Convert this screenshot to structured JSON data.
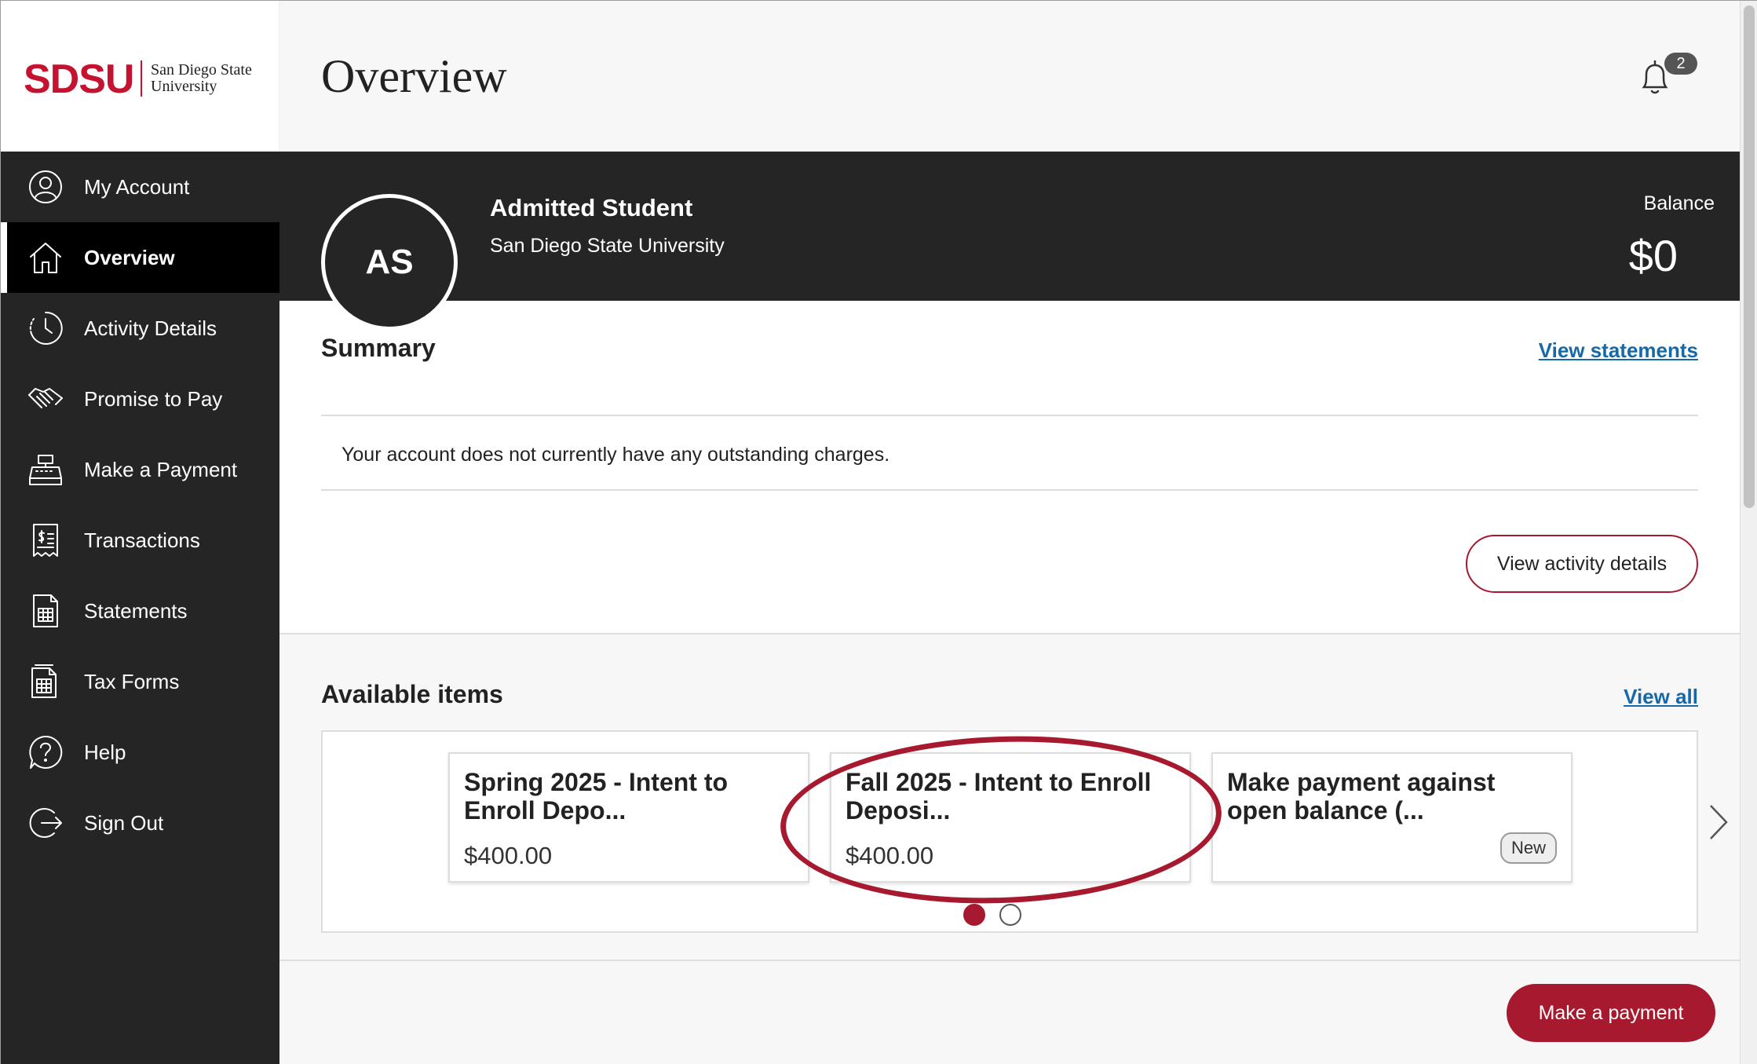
{
  "brand": {
    "logo_mark": "SDSU",
    "logo_line1": "San Diego State",
    "logo_line2": "University",
    "accent_color": "#a6192e"
  },
  "sidebar": {
    "items": [
      {
        "label": "My Account",
        "icon": "user-circle-icon",
        "active": false
      },
      {
        "label": "Overview",
        "icon": "home-icon",
        "active": true
      },
      {
        "label": "Activity Details",
        "icon": "clock-icon",
        "active": false
      },
      {
        "label": "Promise to Pay",
        "icon": "handshake-icon",
        "active": false
      },
      {
        "label": "Make a Payment",
        "icon": "cash-register-icon",
        "active": false
      },
      {
        "label": "Transactions",
        "icon": "receipt-icon",
        "active": false
      },
      {
        "label": "Statements",
        "icon": "document-table-icon",
        "active": false
      },
      {
        "label": "Tax Forms",
        "icon": "tax-form-icon",
        "active": false
      },
      {
        "label": "Help",
        "icon": "help-icon",
        "active": false
      },
      {
        "label": "Sign Out",
        "icon": "sign-out-icon",
        "active": false
      }
    ]
  },
  "header": {
    "title": "Overview",
    "notification_count": "2"
  },
  "profile": {
    "initials": "AS",
    "name": "Admitted Student",
    "institution": "San Diego State University",
    "balance_label": "Balance",
    "balance_value": "$0"
  },
  "summary": {
    "title": "Summary",
    "view_statements_link": "View statements",
    "message": "Your account does not currently have any outstanding charges.",
    "view_activity_button": "View activity details"
  },
  "available_items": {
    "title": "Available items",
    "view_all_link": "View all",
    "cards": [
      {
        "title": "Spring 2025 - Intent to Enroll Depo...",
        "price": "$400.00",
        "badge": ""
      },
      {
        "title": "Fall 2025 - Intent to Enroll Deposi...",
        "price": "$400.00",
        "badge": ""
      },
      {
        "title": "Make payment against open balance (...",
        "price": "",
        "badge": "New"
      }
    ],
    "pages": 2,
    "current_page": 1
  },
  "footer": {
    "make_payment_button": "Make a payment"
  }
}
